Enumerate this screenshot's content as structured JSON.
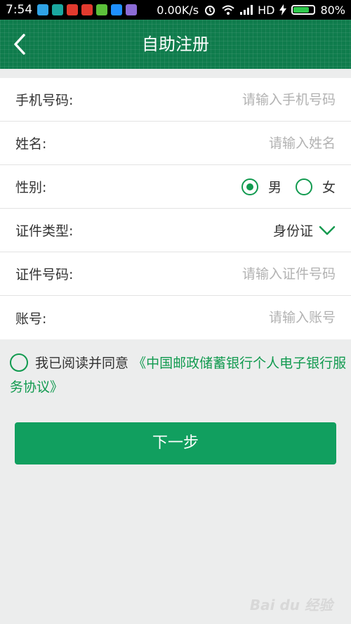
{
  "status_bar": {
    "time": "7:54",
    "net_speed": "0.00K/s",
    "network": "HD",
    "battery_percent": "80%",
    "battery_level": 0.8,
    "app_icon_colors": [
      "#2fa3e6",
      "#1aa8a0",
      "#e23a2e",
      "#e23a2e",
      "#5cc13a",
      "#1e90ff",
      "#8b6cd6"
    ]
  },
  "header": {
    "title": "自助注册",
    "back_icon": "chevron-left-icon"
  },
  "form": {
    "phone": {
      "label": "手机号码:",
      "placeholder": "请输入手机号码",
      "value": ""
    },
    "name": {
      "label": "姓名:",
      "placeholder": "请输入姓名",
      "value": ""
    },
    "gender": {
      "label": "性别:",
      "options": [
        "男",
        "女"
      ],
      "selected": "男"
    },
    "id_type": {
      "label": "证件类型:",
      "value": "身份证",
      "icon": "chevron-down-icon"
    },
    "id_number": {
      "label": "证件号码:",
      "placeholder": "请输入证件号码",
      "value": ""
    },
    "account": {
      "label": "账号:",
      "placeholder": "请输入账号",
      "value": ""
    }
  },
  "agreement": {
    "text": "我已阅读并同意",
    "link": "《中国邮政储蓄银行个人电子银行服务协议》",
    "checked": false
  },
  "next_button": {
    "label": "下一步"
  },
  "watermark": {
    "text": "Bai du 经验"
  },
  "colors": {
    "brand_green": "#119f5f",
    "header_green": "#0f7c4c",
    "accent_green": "#119a4f",
    "background": "#eceded"
  }
}
